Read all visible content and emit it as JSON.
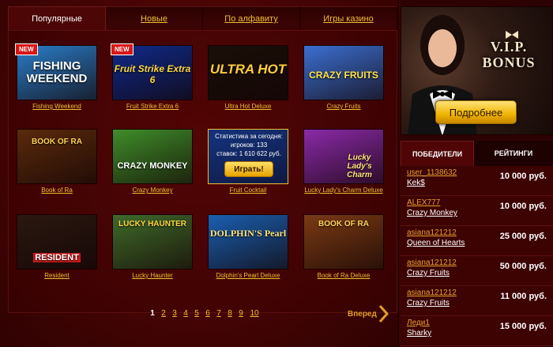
{
  "tabs": [
    {
      "label": "Популярные",
      "active": true
    },
    {
      "label": "Новые",
      "active": false
    },
    {
      "label": "По алфавиту",
      "active": false
    },
    {
      "label": "Игры казино",
      "active": false
    }
  ],
  "games": [
    {
      "name": "Fishing Weekend",
      "thumb_text": "FISHING WEEKEND",
      "is_new": true,
      "new_label": "NEW",
      "bg": "#2a7dc8",
      "fg": "#ffffff"
    },
    {
      "name": "Fruit Strike Extra 6",
      "thumb_text": "Fruit Strike Extra 6",
      "is_new": true,
      "new_label": "NEW",
      "bg": "#0f2a8a",
      "fg": "#ffd640"
    },
    {
      "name": "Ultra Hot Deluxe",
      "thumb_text": "ULTRA HOT",
      "is_new": false,
      "bg": "#1a0f08",
      "fg": "#ffcf3a"
    },
    {
      "name": "Crazy Fruits",
      "thumb_text": "CRAZY FRUITS",
      "is_new": false,
      "bg": "#3b6fd1",
      "fg": "#ffe54a"
    },
    {
      "name": "Book of Ra",
      "thumb_text": "BOOK OF RA",
      "is_new": false,
      "bg": "#5a2a0c",
      "fg": "#ffd25a"
    },
    {
      "name": "Crazy Monkey",
      "thumb_text": "CRAZY MONKEY",
      "is_new": false,
      "bg": "#3f8d2a",
      "fg": "#ffffff"
    },
    {
      "name": "Fruit Cocktail",
      "thumb_text": "",
      "is_new": false,
      "bg": "#234fa8",
      "fg": "#ffffff",
      "hover": true,
      "stats_line1": "Статистика за сегодня:",
      "stats_line2": "игроков: 133",
      "stats_line3": "ставок: 1 610 622 руб.",
      "play_label": "Играть!"
    },
    {
      "name": "Lucky Lady's Charm Deluxe",
      "thumb_text": "Lucky Lady's Charm",
      "is_new": false,
      "bg": "#8a2aa8",
      "fg": "#ffe27a"
    },
    {
      "name": "Resident",
      "thumb_text": "RESIDENT",
      "is_new": false,
      "bg": "#2a1810",
      "fg": "#ffffff"
    },
    {
      "name": "Lucky Haunter",
      "thumb_text": "LUCKY HAUNTER",
      "is_new": false,
      "bg": "#3f6a2a",
      "fg": "#ffd640"
    },
    {
      "name": "Dolphin's Pearl Deluxe",
      "thumb_text": "DOLPHIN'S Pearl",
      "is_new": false,
      "bg": "#1a5fb0",
      "fg": "#ffe27a"
    },
    {
      "name": "Book of Ra Deluxe",
      "thumb_text": "BOOK OF RA",
      "is_new": false,
      "bg": "#7a3a14",
      "fg": "#ffd25a"
    }
  ],
  "pagination": {
    "pages": [
      "1",
      "2",
      "3",
      "4",
      "5",
      "6",
      "7",
      "8",
      "9",
      "10"
    ],
    "current": "1",
    "next_label": "Вперед"
  },
  "banner": {
    "vip_line1": "V.I.P.",
    "vip_line2": "BONUS",
    "more_label": "Подробнее"
  },
  "winner_tabs": [
    {
      "label": "ПОБЕДИТЕЛИ",
      "active": true
    },
    {
      "label": "РЕЙТИНГИ",
      "active": false
    }
  ],
  "winners": [
    {
      "user": "user_1138632",
      "game": "Kek$",
      "amount": "10 000 руб."
    },
    {
      "user": "ALEX777",
      "game": "Crazy Monkey",
      "amount": "10 000 руб."
    },
    {
      "user": "asiana121212",
      "game": "Queen of Hearts",
      "amount": "25 000 руб."
    },
    {
      "user": "asiana121212",
      "game": "Crazy Fruits",
      "amount": "50 000 руб."
    },
    {
      "user": "asiana121212",
      "game": "Crazy Fruits",
      "amount": "11 000 руб."
    },
    {
      "user": "Леди1",
      "game": "Sharky",
      "amount": "15 000 руб."
    }
  ],
  "colors": {
    "background": "#3a0303",
    "link_gold": "#f0c030",
    "button_gold": "#f0b400",
    "panel": "#470404"
  }
}
